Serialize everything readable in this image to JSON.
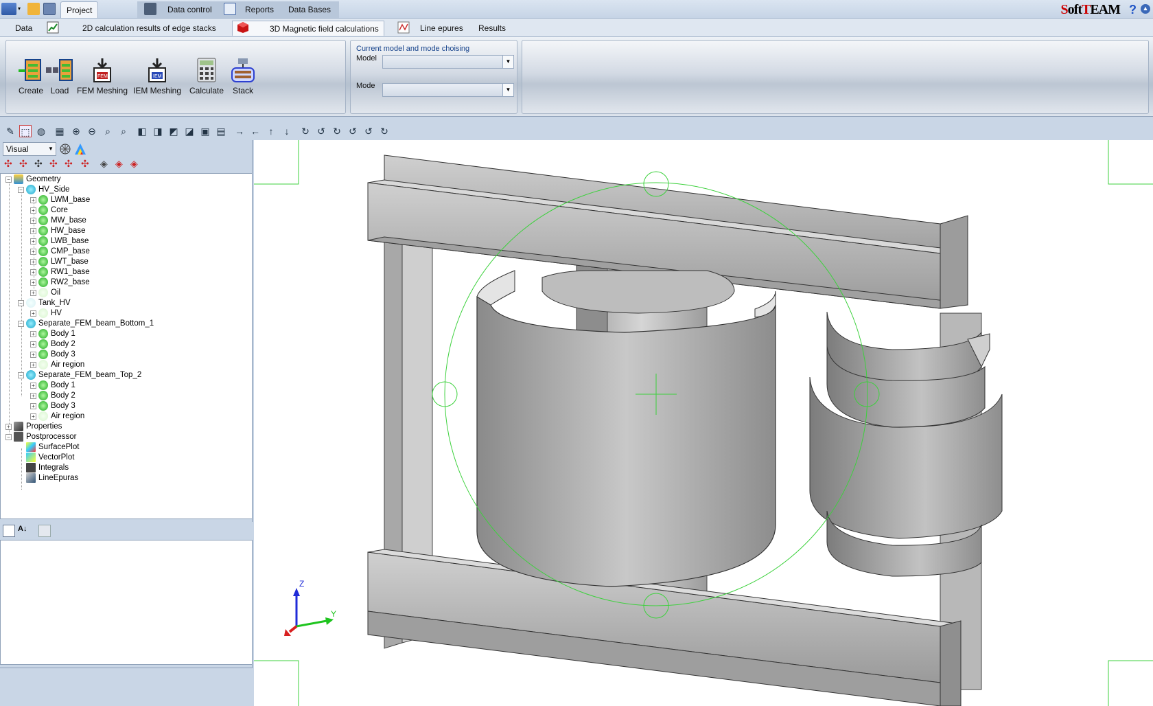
{
  "top_menu": {
    "tabs": [
      {
        "label": "Project"
      },
      {
        "label": "Data control"
      },
      {
        "label": "Reports"
      },
      {
        "label": "Data Bases"
      }
    ],
    "brand": "SoftTEAM",
    "help": "?"
  },
  "sub_tabs": [
    {
      "label": "Data"
    },
    {
      "label": "2D calculation results of edge stacks"
    },
    {
      "label": "3D Magnetic field calculations"
    },
    {
      "label": "Line epures"
    },
    {
      "label": "Results"
    }
  ],
  "ribbon": {
    "buttons": [
      {
        "label": "Create"
      },
      {
        "label": "Load"
      },
      {
        "label": "FEM Meshing"
      },
      {
        "label": "IEM Meshing"
      },
      {
        "label": "Calculate"
      },
      {
        "label": "Stack"
      }
    ],
    "model_group": {
      "title": "Current model and mode choising",
      "model_label": "Model",
      "model_value": "",
      "mode_label": "Mode",
      "mode_value": ""
    }
  },
  "left_panel": {
    "view_mode": "Visual",
    "tree": {
      "geometry": "Geometry",
      "hv_side": "HV_Side",
      "hv_side_items": [
        "LWM_base",
        "Core",
        "MW_base",
        "HW_base",
        "LWB_base",
        "CMP_base",
        "LWT_base",
        "RW1_base",
        "RW2_base",
        "Oil"
      ],
      "tank_hv": "Tank_HV",
      "tank_hv_items": [
        "HV"
      ],
      "beam_bottom": "Separate_FEM_beam_Bottom_1",
      "beam_bottom_items": [
        "Body 1",
        "Body 2",
        "Body 3",
        "Air region"
      ],
      "beam_top": "Separate_FEM_beam_Top_2",
      "beam_top_items": [
        "Body 1",
        "Body 2",
        "Body 3",
        "Air region"
      ],
      "properties": "Properties",
      "postprocessor": "Postprocessor",
      "post_items": [
        "SurfacePlot",
        "VectorPlot",
        "Integrals",
        "LineEpuras"
      ]
    }
  },
  "axes": {
    "z": "Z",
    "y": "Y"
  },
  "colors": {
    "accent": "#15428b",
    "tree_green": "#2fbf2f",
    "tree_cyan": "#22b9d8",
    "brand_red": "#cc0000"
  }
}
